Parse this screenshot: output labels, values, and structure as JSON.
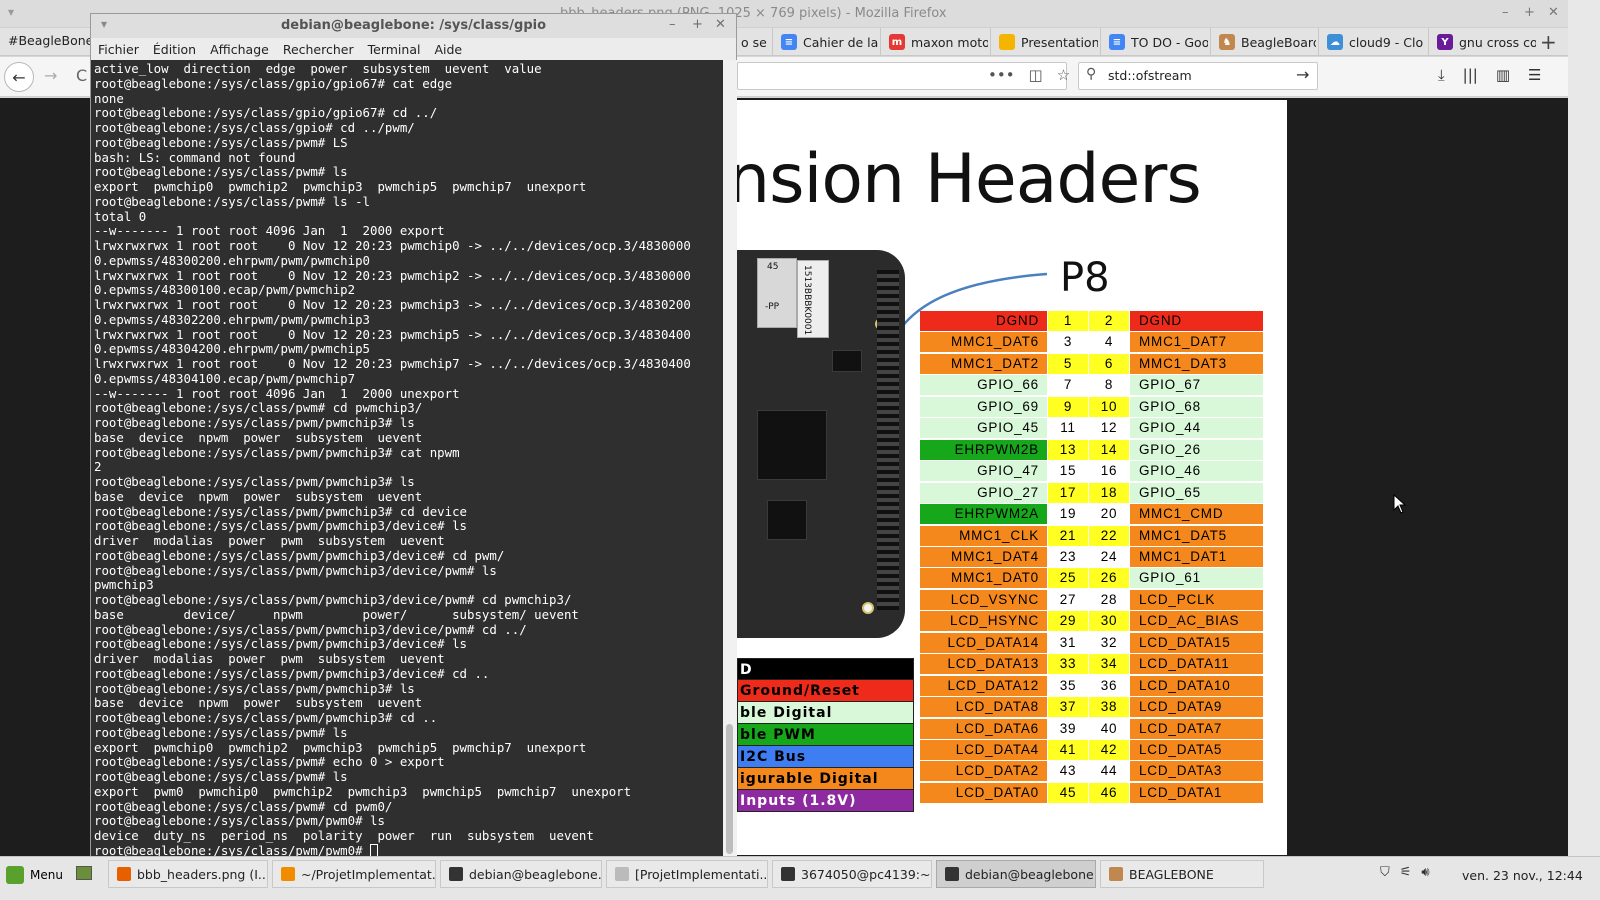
{
  "firefox": {
    "window_title": "bbb_headers.png (PNG, 1025 × 769 pixels) - Mozilla Firefox",
    "first_tab": "#BeagleBone B",
    "tabs": [
      {
        "label": "o se",
        "color": "#9aa0a6",
        "glyph": ""
      },
      {
        "label": "Cahier de la",
        "color": "#4285f4",
        "glyph": "≡"
      },
      {
        "label": "maxon moto",
        "color": "#e53935",
        "glyph": "m"
      },
      {
        "label": "Presentation",
        "color": "#f4b400",
        "glyph": ""
      },
      {
        "label": "TO DO - Goo",
        "color": "#4285f4",
        "glyph": "≡"
      },
      {
        "label": "BeagleBoard",
        "color": "#c0874f",
        "glyph": "♞"
      },
      {
        "label": "cloud9 - Clo",
        "color": "#3d8fd8",
        "glyph": "☁"
      },
      {
        "label": "gnu cross co",
        "color": "#6a1b9a",
        "glyph": "Y"
      }
    ],
    "search_value": "std::ofstream",
    "image": {
      "heading": "nsion Headers",
      "connector": "P8",
      "legend": [
        {
          "label": "D",
          "bg": "#000000",
          "fg": "#ffffff"
        },
        {
          "label": "Ground/Reset",
          "bg": "#ee2a1b",
          "fg": "#000000"
        },
        {
          "label": "ble Digital",
          "bg": "#d9f7d9",
          "fg": "#000000"
        },
        {
          "label": "ble PWM",
          "bg": "#16a81a",
          "fg": "#000000"
        },
        {
          "label": "I2C Bus",
          "bg": "#3f7ef2",
          "fg": "#000000"
        },
        {
          "label": "igurable Digital",
          "bg": "#f4881c",
          "fg": "#000000"
        },
        {
          "label": "Inputs (1.8V)",
          "bg": "#8e2aa0",
          "fg": "#ffffff"
        }
      ],
      "pins": [
        {
          "l": "DGND",
          "ln": "1",
          "rn": "2",
          "r": "DGND",
          "lc": "#ee2a1b",
          "rc": "#ee2a1b",
          "lh": true,
          "rh": true
        },
        {
          "l": "MMC1_DAT6",
          "ln": "3",
          "rn": "4",
          "r": "MMC1_DAT7",
          "lc": "#f4881c",
          "rc": "#f4881c",
          "lh": false,
          "rh": false
        },
        {
          "l": "MMC1_DAT2",
          "ln": "5",
          "rn": "6",
          "r": "MMC1_DAT3",
          "lc": "#f4881c",
          "rc": "#f4881c",
          "lh": true,
          "rh": true
        },
        {
          "l": "GPIO_66",
          "ln": "7",
          "rn": "8",
          "r": "GPIO_67",
          "lc": "#d9f7d9",
          "rc": "#d9f7d9",
          "lh": false,
          "rh": false
        },
        {
          "l": "GPIO_69",
          "ln": "9",
          "rn": "10",
          "r": "GPIO_68",
          "lc": "#d9f7d9",
          "rc": "#d9f7d9",
          "lh": true,
          "rh": true
        },
        {
          "l": "GPIO_45",
          "ln": "11",
          "rn": "12",
          "r": "GPIO_44",
          "lc": "#d9f7d9",
          "rc": "#d9f7d9",
          "lh": false,
          "rh": false
        },
        {
          "l": "EHRPWM2B",
          "ln": "13",
          "rn": "14",
          "r": "GPIO_26",
          "lc": "#16a81a",
          "rc": "#d9f7d9",
          "lh": true,
          "rh": true
        },
        {
          "l": "GPIO_47",
          "ln": "15",
          "rn": "16",
          "r": "GPIO_46",
          "lc": "#d9f7d9",
          "rc": "#d9f7d9",
          "lh": false,
          "rh": false
        },
        {
          "l": "GPIO_27",
          "ln": "17",
          "rn": "18",
          "r": "GPIO_65",
          "lc": "#d9f7d9",
          "rc": "#d9f7d9",
          "lh": true,
          "rh": true
        },
        {
          "l": "EHRPWM2A",
          "ln": "19",
          "rn": "20",
          "r": "MMC1_CMD",
          "lc": "#16a81a",
          "rc": "#f4881c",
          "lh": false,
          "rh": false
        },
        {
          "l": "MMC1_CLK",
          "ln": "21",
          "rn": "22",
          "r": "MMC1_DAT5",
          "lc": "#f4881c",
          "rc": "#f4881c",
          "lh": true,
          "rh": true
        },
        {
          "l": "MMC1_DAT4",
          "ln": "23",
          "rn": "24",
          "r": "MMC1_DAT1",
          "lc": "#f4881c",
          "rc": "#f4881c",
          "lh": false,
          "rh": false
        },
        {
          "l": "MMC1_DAT0",
          "ln": "25",
          "rn": "26",
          "r": "GPIO_61",
          "lc": "#f4881c",
          "rc": "#d9f7d9",
          "lh": true,
          "rh": true
        },
        {
          "l": "LCD_VSYNC",
          "ln": "27",
          "rn": "28",
          "r": "LCD_PCLK",
          "lc": "#f4881c",
          "rc": "#f4881c",
          "lh": false,
          "rh": false
        },
        {
          "l": "LCD_HSYNC",
          "ln": "29",
          "rn": "30",
          "r": "LCD_AC_BIAS",
          "lc": "#f4881c",
          "rc": "#f4881c",
          "lh": true,
          "rh": true
        },
        {
          "l": "LCD_DATA14",
          "ln": "31",
          "rn": "32",
          "r": "LCD_DATA15",
          "lc": "#f4881c",
          "rc": "#f4881c",
          "lh": false,
          "rh": false
        },
        {
          "l": "LCD_DATA13",
          "ln": "33",
          "rn": "34",
          "r": "LCD_DATA11",
          "lc": "#f4881c",
          "rc": "#f4881c",
          "lh": true,
          "rh": true
        },
        {
          "l": "LCD_DATA12",
          "ln": "35",
          "rn": "36",
          "r": "LCD_DATA10",
          "lc": "#f4881c",
          "rc": "#f4881c",
          "lh": false,
          "rh": false
        },
        {
          "l": "LCD_DATA8",
          "ln": "37",
          "rn": "38",
          "r": "LCD_DATA9",
          "lc": "#f4881c",
          "rc": "#f4881c",
          "lh": true,
          "rh": true
        },
        {
          "l": "LCD_DATA6",
          "ln": "39",
          "rn": "40",
          "r": "LCD_DATA7",
          "lc": "#f4881c",
          "rc": "#f4881c",
          "lh": false,
          "rh": false
        },
        {
          "l": "LCD_DATA4",
          "ln": "41",
          "rn": "42",
          "r": "LCD_DATA5",
          "lc": "#f4881c",
          "rc": "#f4881c",
          "lh": true,
          "rh": true
        },
        {
          "l": "LCD_DATA2",
          "ln": "43",
          "rn": "44",
          "r": "LCD_DATA3",
          "lc": "#f4881c",
          "rc": "#f4881c",
          "lh": false,
          "rh": false
        },
        {
          "l": "LCD_DATA0",
          "ln": "45",
          "rn": "46",
          "r": "LCD_DATA1",
          "lc": "#f4881c",
          "rc": "#f4881c",
          "lh": true,
          "rh": true
        }
      ],
      "board_text": {
        "a": "45",
        "b": "1513BBBK0001",
        "c": "-PP"
      }
    }
  },
  "terminal": {
    "title": "debian@beaglebone: /sys/class/gpio",
    "menu": [
      "Fichier",
      "Édition",
      "Affichage",
      "Rechercher",
      "Terminal",
      "Aide"
    ],
    "lines": [
      "active_low  direction  edge  power  subsystem  uevent  value",
      "root@beaglebone:/sys/class/gpio/gpio67# cat edge",
      "none",
      "root@beaglebone:/sys/class/gpio/gpio67# cd ../",
      "root@beaglebone:/sys/class/gpio# cd ../pwm/",
      "root@beaglebone:/sys/class/pwm# LS",
      "bash: LS: command not found",
      "root@beaglebone:/sys/class/pwm# ls",
      "export  pwmchip0  pwmchip2  pwmchip3  pwmchip5  pwmchip7  unexport",
      "root@beaglebone:/sys/class/pwm# ls -l",
      "total 0",
      "--w------- 1 root root 4096 Jan  1  2000 export",
      "lrwxrwxrwx 1 root root    0 Nov 12 20:23 pwmchip0 -> ../../devices/ocp.3/4830000",
      "0.epwmss/48300200.ehrpwm/pwm/pwmchip0",
      "lrwxrwxrwx 1 root root    0 Nov 12 20:23 pwmchip2 -> ../../devices/ocp.3/4830000",
      "0.epwmss/48300100.ecap/pwm/pwmchip2",
      "lrwxrwxrwx 1 root root    0 Nov 12 20:23 pwmchip3 -> ../../devices/ocp.3/4830200",
      "0.epwmss/48302200.ehrpwm/pwm/pwmchip3",
      "lrwxrwxrwx 1 root root    0 Nov 12 20:23 pwmchip5 -> ../../devices/ocp.3/4830400",
      "0.epwmss/48304200.ehrpwm/pwm/pwmchip5",
      "lrwxrwxrwx 1 root root    0 Nov 12 20:23 pwmchip7 -> ../../devices/ocp.3/4830400",
      "0.epwmss/48304100.ecap/pwm/pwmchip7",
      "--w------- 1 root root 4096 Jan  1  2000 unexport",
      "root@beaglebone:/sys/class/pwm# cd pwmchip3/",
      "root@beaglebone:/sys/class/pwm/pwmchip3# ls",
      "base  device  npwm  power  subsystem  uevent",
      "root@beaglebone:/sys/class/pwm/pwmchip3# cat npwm",
      "2",
      "root@beaglebone:/sys/class/pwm/pwmchip3# ls",
      "base  device  npwm  power  subsystem  uevent",
      "root@beaglebone:/sys/class/pwm/pwmchip3# cd device",
      "root@beaglebone:/sys/class/pwm/pwmchip3/device# ls",
      "driver  modalias  power  pwm  subsystem  uevent",
      "root@beaglebone:/sys/class/pwm/pwmchip3/device# cd pwm/",
      "root@beaglebone:/sys/class/pwm/pwmchip3/device/pwm# ls",
      "pwmchip3",
      "root@beaglebone:/sys/class/pwm/pwmchip3/device/pwm# cd pwmchip3/",
      "base        device/     npwm        power/      subsystem/ uevent",
      "root@beaglebone:/sys/class/pwm/pwmchip3/device/pwm# cd ../",
      "root@beaglebone:/sys/class/pwm/pwmchip3/device# ls",
      "driver  modalias  power  pwm  subsystem  uevent",
      "root@beaglebone:/sys/class/pwm/pwmchip3/device# cd ..",
      "root@beaglebone:/sys/class/pwm/pwmchip3# ls",
      "base  device  npwm  power  subsystem  uevent",
      "root@beaglebone:/sys/class/pwm/pwmchip3# cd ..",
      "root@beaglebone:/sys/class/pwm# ls",
      "export  pwmchip0  pwmchip2  pwmchip3  pwmchip5  pwmchip7  unexport",
      "root@beaglebone:/sys/class/pwm# echo 0 > export",
      "root@beaglebone:/sys/class/pwm# ls",
      "export  pwm0  pwmchip0  pwmchip2  pwmchip3  pwmchip5  pwmchip7  unexport",
      "root@beaglebone:/sys/class/pwm# cd pwm0/",
      "root@beaglebone:/sys/class/pwm/pwm0# ls",
      "device  duty_ns  period_ns  polarity  power  run  subsystem  uevent"
    ],
    "prompt": "root@beaglebone:/sys/class/pwm/pwm0# "
  },
  "taskbar": {
    "menu_label": "Menu",
    "tasks": [
      {
        "label": "bbb_headers.png (I...",
        "color": "#e66000",
        "active": false
      },
      {
        "label": "~/ProjetImplementat...",
        "color": "#f08c00",
        "active": false
      },
      {
        "label": "debian@beaglebone...",
        "color": "#333333",
        "active": false
      },
      {
        "label": "[ProjetImplementati...",
        "color": "#bbbbbb",
        "active": false
      },
      {
        "label": "3674050@pc4139:~",
        "color": "#333333",
        "active": false
      },
      {
        "label": "debian@beaglebone...",
        "color": "#333333",
        "active": true
      },
      {
        "label": "BEAGLEBONE",
        "color": "#c0874f",
        "active": false
      }
    ],
    "clock": "ven. 23 nov., 12:44"
  }
}
